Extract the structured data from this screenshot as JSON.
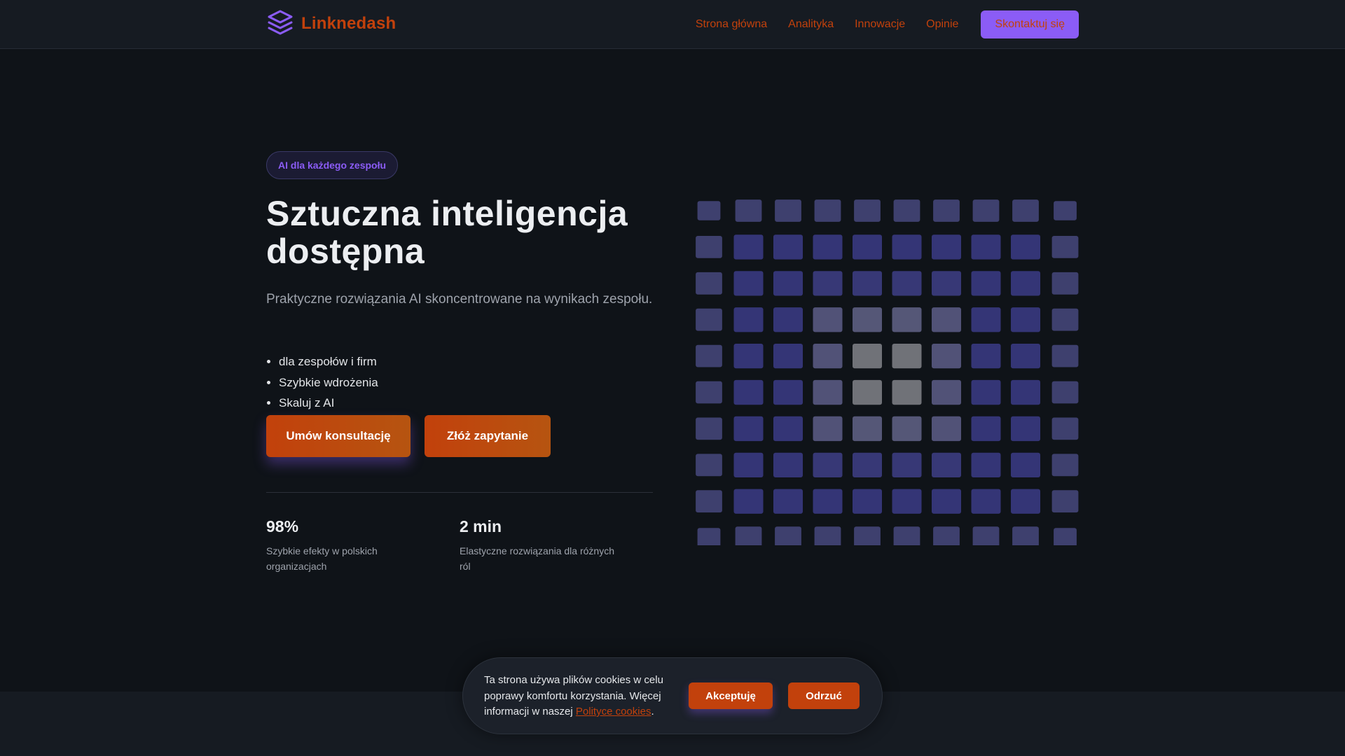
{
  "colors": {
    "accent_orange": "#c2410c",
    "accent_purple": "#8b5cf6",
    "background": "#0f1318",
    "nav_background": "#161b22",
    "badge_text": "#8b5cf6"
  },
  "header": {
    "logo_icon": "layers-icon",
    "brand": "Linknedash",
    "nav": [
      "Strona główna",
      "Analityka",
      "Innowacje",
      "Opinie"
    ],
    "cta": "Skontaktuj się"
  },
  "hero": {
    "badge": "AI dla każdego zespołu",
    "title_line1": "Sztuczna inteligencja",
    "title_line2": "dostępna",
    "subtitle": "Praktyczne rozwiązania AI skoncentrowane na wynikach zespołu.",
    "features": [
      "dla zespołów i firm",
      "Szybkie wdrożenia",
      "Skaluj z AI"
    ],
    "primary_button": "Umów konsultację",
    "secondary_button": "Złóż zapytanie",
    "stats": [
      {
        "value": "98%",
        "label": "Szybkie efekty w polskich organizacjach"
      },
      {
        "value": "2 min",
        "label": "Elastyczne rozwiązania dla różnych ról"
      }
    ]
  },
  "visual": {
    "icon": "tile-grid-graphic"
  },
  "cookie_banner": {
    "text": "Ta strona używa plików cookies w celu poprawy komfortu korzystania. Więcej informacji w naszej ",
    "link": "Polityce cookies",
    "suffix": ".",
    "accept": "Akceptuję",
    "reject": "Odrzuć"
  }
}
